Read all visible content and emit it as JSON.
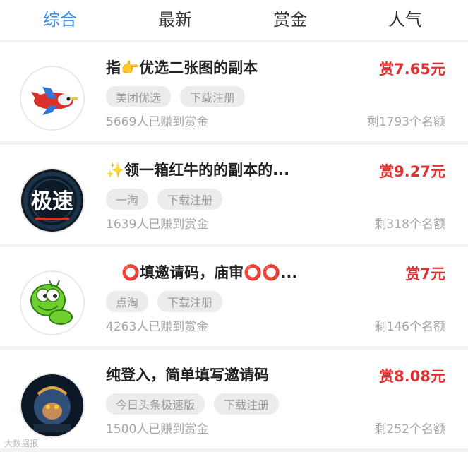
{
  "tabs": [
    {
      "label": "综合",
      "active": true
    },
    {
      "label": "最新"
    },
    {
      "label": "赏金"
    },
    {
      "label": "人气"
    }
  ],
  "items": [
    {
      "avatar": "plane-avatar",
      "title": "指👉优选二张图的副本",
      "reward": "赏7.65元",
      "tags": [
        "美团优选",
        "下载注册"
      ],
      "earned": "5669人已赚到赏金",
      "remaining": "剩1793个名额"
    },
    {
      "avatar": "speed-app-avatar",
      "title": "✨领一箱红牛的的副本的...",
      "reward": "赏9.27元",
      "tags": [
        "一淘",
        "下载注册"
      ],
      "earned": "1639人已赚到赏金",
      "remaining": "剩318个名额"
    },
    {
      "avatar": "caterpillar-avatar",
      "title": "⭕填邀请码，庙审⭕⭕...",
      "reward": "赏7元",
      "tags": [
        "点淘",
        "下载注册"
      ],
      "earned": "4263人已赚到赏金",
      "remaining": "剩146个名额"
    },
    {
      "avatar": "monkey-king-avatar",
      "title": "纯登入，简单填写邀请码",
      "reward": "赏8.08元",
      "tags": [
        "今日头条极速版",
        "下载注册"
      ],
      "earned": "1500人已赚到赏金",
      "remaining": "剩252个名额"
    }
  ],
  "watermark": "大数据报"
}
